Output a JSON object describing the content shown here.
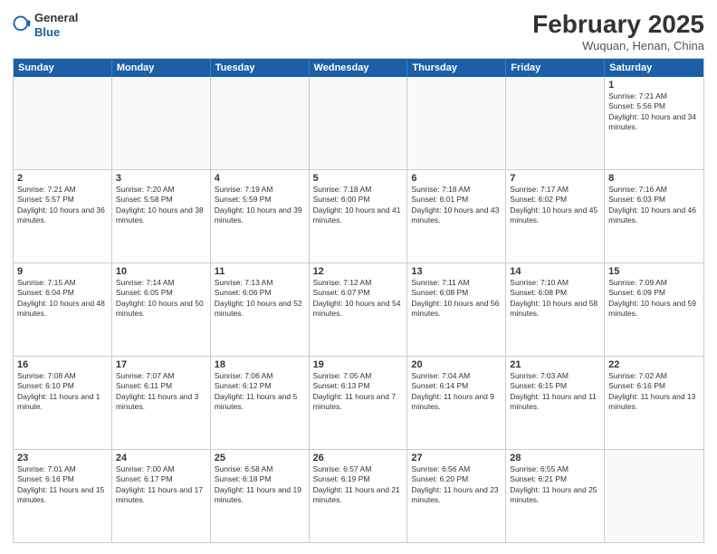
{
  "header": {
    "logo_general": "General",
    "logo_blue": "Blue",
    "month_year": "February 2025",
    "location": "Wuquan, Henan, China"
  },
  "weekdays": [
    "Sunday",
    "Monday",
    "Tuesday",
    "Wednesday",
    "Thursday",
    "Friday",
    "Saturday"
  ],
  "rows": [
    [
      {
        "day": "",
        "text": ""
      },
      {
        "day": "",
        "text": ""
      },
      {
        "day": "",
        "text": ""
      },
      {
        "day": "",
        "text": ""
      },
      {
        "day": "",
        "text": ""
      },
      {
        "day": "",
        "text": ""
      },
      {
        "day": "1",
        "text": "Sunrise: 7:21 AM\nSunset: 5:56 PM\nDaylight: 10 hours and 34 minutes."
      }
    ],
    [
      {
        "day": "2",
        "text": "Sunrise: 7:21 AM\nSunset: 5:57 PM\nDaylight: 10 hours and 36 minutes."
      },
      {
        "day": "3",
        "text": "Sunrise: 7:20 AM\nSunset: 5:58 PM\nDaylight: 10 hours and 38 minutes."
      },
      {
        "day": "4",
        "text": "Sunrise: 7:19 AM\nSunset: 5:59 PM\nDaylight: 10 hours and 39 minutes."
      },
      {
        "day": "5",
        "text": "Sunrise: 7:18 AM\nSunset: 6:00 PM\nDaylight: 10 hours and 41 minutes."
      },
      {
        "day": "6",
        "text": "Sunrise: 7:18 AM\nSunset: 6:01 PM\nDaylight: 10 hours and 43 minutes."
      },
      {
        "day": "7",
        "text": "Sunrise: 7:17 AM\nSunset: 6:02 PM\nDaylight: 10 hours and 45 minutes."
      },
      {
        "day": "8",
        "text": "Sunrise: 7:16 AM\nSunset: 6:03 PM\nDaylight: 10 hours and 46 minutes."
      }
    ],
    [
      {
        "day": "9",
        "text": "Sunrise: 7:15 AM\nSunset: 6:04 PM\nDaylight: 10 hours and 48 minutes."
      },
      {
        "day": "10",
        "text": "Sunrise: 7:14 AM\nSunset: 6:05 PM\nDaylight: 10 hours and 50 minutes."
      },
      {
        "day": "11",
        "text": "Sunrise: 7:13 AM\nSunset: 6:06 PM\nDaylight: 10 hours and 52 minutes."
      },
      {
        "day": "12",
        "text": "Sunrise: 7:12 AM\nSunset: 6:07 PM\nDaylight: 10 hours and 54 minutes."
      },
      {
        "day": "13",
        "text": "Sunrise: 7:11 AM\nSunset: 6:08 PM\nDaylight: 10 hours and 56 minutes."
      },
      {
        "day": "14",
        "text": "Sunrise: 7:10 AM\nSunset: 6:08 PM\nDaylight: 10 hours and 58 minutes."
      },
      {
        "day": "15",
        "text": "Sunrise: 7:09 AM\nSunset: 6:09 PM\nDaylight: 10 hours and 59 minutes."
      }
    ],
    [
      {
        "day": "16",
        "text": "Sunrise: 7:08 AM\nSunset: 6:10 PM\nDaylight: 11 hours and 1 minute."
      },
      {
        "day": "17",
        "text": "Sunrise: 7:07 AM\nSunset: 6:11 PM\nDaylight: 11 hours and 3 minutes."
      },
      {
        "day": "18",
        "text": "Sunrise: 7:06 AM\nSunset: 6:12 PM\nDaylight: 11 hours and 5 minutes."
      },
      {
        "day": "19",
        "text": "Sunrise: 7:05 AM\nSunset: 6:13 PM\nDaylight: 11 hours and 7 minutes."
      },
      {
        "day": "20",
        "text": "Sunrise: 7:04 AM\nSunset: 6:14 PM\nDaylight: 11 hours and 9 minutes."
      },
      {
        "day": "21",
        "text": "Sunrise: 7:03 AM\nSunset: 6:15 PM\nDaylight: 11 hours and 11 minutes."
      },
      {
        "day": "22",
        "text": "Sunrise: 7:02 AM\nSunset: 6:16 PM\nDaylight: 11 hours and 13 minutes."
      }
    ],
    [
      {
        "day": "23",
        "text": "Sunrise: 7:01 AM\nSunset: 6:16 PM\nDaylight: 11 hours and 15 minutes."
      },
      {
        "day": "24",
        "text": "Sunrise: 7:00 AM\nSunset: 6:17 PM\nDaylight: 11 hours and 17 minutes."
      },
      {
        "day": "25",
        "text": "Sunrise: 6:58 AM\nSunset: 6:18 PM\nDaylight: 11 hours and 19 minutes."
      },
      {
        "day": "26",
        "text": "Sunrise: 6:57 AM\nSunset: 6:19 PM\nDaylight: 11 hours and 21 minutes."
      },
      {
        "day": "27",
        "text": "Sunrise: 6:56 AM\nSunset: 6:20 PM\nDaylight: 11 hours and 23 minutes."
      },
      {
        "day": "28",
        "text": "Sunrise: 6:55 AM\nSunset: 6:21 PM\nDaylight: 11 hours and 25 minutes."
      },
      {
        "day": "",
        "text": ""
      }
    ]
  ]
}
